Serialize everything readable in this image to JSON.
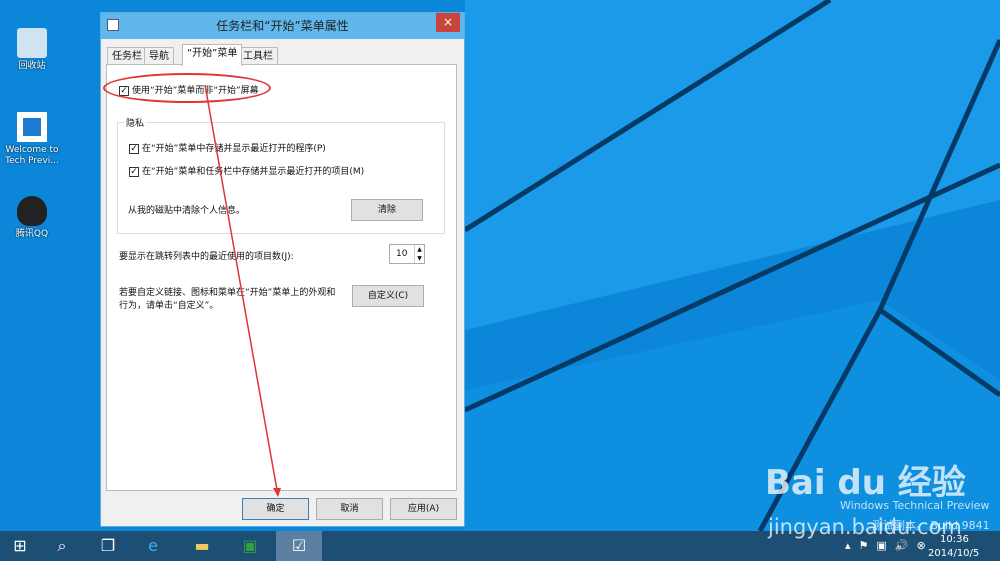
{
  "desktop": {
    "icons": [
      {
        "label": "回收站"
      },
      {
        "label": "Welcome to Tech Previ..."
      },
      {
        "label": "腾讯QQ"
      }
    ]
  },
  "dialog": {
    "title": "任务栏和“开始”菜单属性",
    "close": "×",
    "tabs": [
      "任务栏",
      "导航",
      "“开始”菜单",
      "工具栏"
    ],
    "use_start_menu": "使用“开始”菜单而非“开始”屏幕",
    "privacy": {
      "legend": "隐私",
      "opt1": "在“开始”菜单中存储并显示最近打开的程序(P)",
      "opt2": "在“开始”菜单和任务栏中存储并显示最近打开的项目(M)",
      "clear_text": "从我的磁贴中清除个人信息。",
      "clear_btn": "清除"
    },
    "jumplist_label": "要显示在跳转列表中的最近使用的项目数(J):",
    "jumplist_value": "10",
    "customize_text1": "若要自定义链接、图标和菜单在“开始”菜单上的外观和",
    "customize_text2": "行为，请单击“自定义”。",
    "customize_btn": "自定义(C)",
    "ok": "确定",
    "cancel": "取消",
    "apply": "应用(A)"
  },
  "watermark": {
    "line1": "Windows Technical Preview",
    "line2": "测试副本。 Build 9841",
    "brand": "Bai du 经验",
    "url": "jingyan.baidu.com"
  },
  "taskbar": {
    "time": "10:36",
    "date": "2014/10/5"
  }
}
